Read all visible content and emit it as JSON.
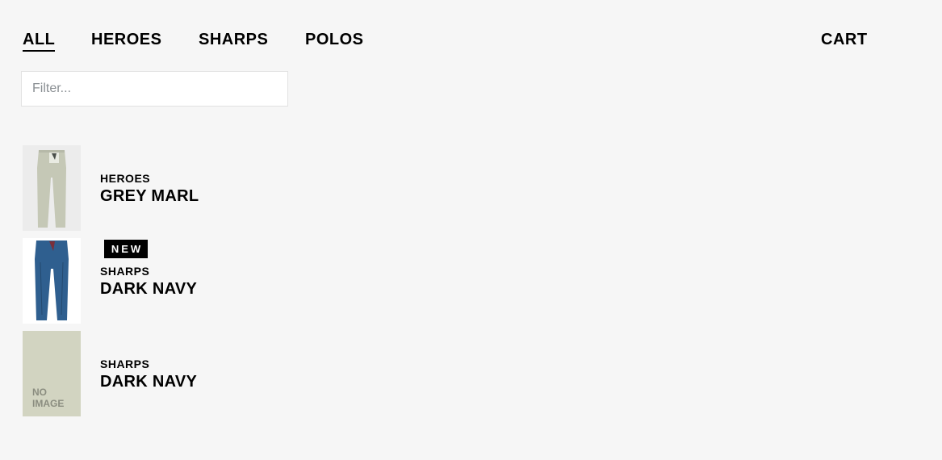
{
  "nav": {
    "tabs": [
      {
        "label": "ALL",
        "active": true
      },
      {
        "label": "HEROES",
        "active": false
      },
      {
        "label": "SHARPS",
        "active": false
      },
      {
        "label": "POLOS",
        "active": false
      }
    ],
    "cart_label": "CART"
  },
  "filter": {
    "placeholder": "Filter...",
    "value": ""
  },
  "products": [
    {
      "category": "HEROES",
      "name": "GREY MARL",
      "badge": "",
      "image": "grey-trousers",
      "image_color": "#c9cbbd"
    },
    {
      "category": "SHARPS",
      "name": "DARK NAVY",
      "badge": "NEW",
      "image": "denim-trousers",
      "image_color": "#2f5f8f"
    },
    {
      "category": "SHARPS",
      "name": "DARK NAVY",
      "badge": "",
      "image": "no-image",
      "image_text_line1": "NO",
      "image_text_line2": "IMAGE"
    }
  ]
}
